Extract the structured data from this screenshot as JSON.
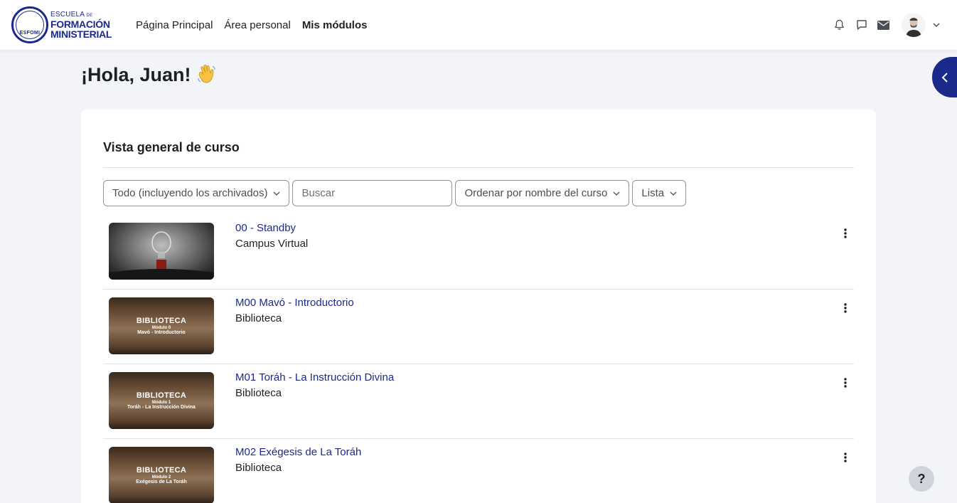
{
  "logo": {
    "line1": "ESCUELA",
    "line1_small": "DE",
    "line2": "FORMACIÓN",
    "line3": "MINISTERIAL",
    "seal_text": "ESFOMI"
  },
  "nav": {
    "links": [
      {
        "label": "Página Principal",
        "active": false
      },
      {
        "label": "Área personal",
        "active": false
      },
      {
        "label": "Mis módulos",
        "active": true
      }
    ],
    "icons": [
      "bell-icon",
      "chat-icon",
      "mail-icon"
    ]
  },
  "greeting": {
    "text": "¡Hola, Juan!",
    "emoji_icon": "waving-hand-icon"
  },
  "overview": {
    "title": "Vista general de curso",
    "filter_label": "Todo (incluyendo los archivados)",
    "search_placeholder": "Buscar",
    "sort_label": "Ordenar por nombre del curso",
    "view_label": "Lista"
  },
  "courses": [
    {
      "name": "00 - Standby",
      "category": "Campus Virtual",
      "image": "lightbulb"
    },
    {
      "name": "M00 Mavó - Introductorio",
      "category": "Biblioteca",
      "image": "book",
      "overlay_title": "BIBLIOTECA",
      "overlay_sub": "Módulo 0",
      "overlay_name": "Mavó - Introductorio"
    },
    {
      "name": "M01 Toráh - La Instrucción Divina",
      "category": "Biblioteca",
      "image": "book",
      "overlay_title": "BIBLIOTECA",
      "overlay_sub": "Módulo 1",
      "overlay_name": "Toráh - La Instrucción Divina"
    },
    {
      "name": "M02 Exégesis de La Toráh",
      "category": "Biblioteca",
      "image": "book",
      "overlay_title": "BIBLIOTECA",
      "overlay_sub": "Módulo 2",
      "overlay_name": "Exégesis de La Toráh"
    }
  ],
  "help": {
    "label": "?"
  },
  "colors": {
    "brand": "#1b2a8a",
    "page_bg": "#f3f4f8",
    "link": "#1b2a8a"
  }
}
